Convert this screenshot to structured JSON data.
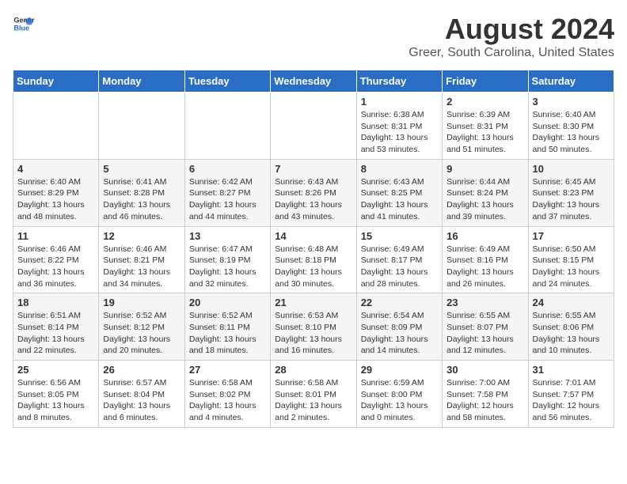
{
  "logo": {
    "line1": "General",
    "line2": "Blue"
  },
  "title": "August 2024",
  "subtitle": "Greer, South Carolina, United States",
  "weekdays": [
    "Sunday",
    "Monday",
    "Tuesday",
    "Wednesday",
    "Thursday",
    "Friday",
    "Saturday"
  ],
  "weeks": [
    [
      {
        "day": "",
        "info": ""
      },
      {
        "day": "",
        "info": ""
      },
      {
        "day": "",
        "info": ""
      },
      {
        "day": "",
        "info": ""
      },
      {
        "day": "1",
        "info": "Sunrise: 6:38 AM\nSunset: 8:31 PM\nDaylight: 13 hours\nand 53 minutes."
      },
      {
        "day": "2",
        "info": "Sunrise: 6:39 AM\nSunset: 8:31 PM\nDaylight: 13 hours\nand 51 minutes."
      },
      {
        "day": "3",
        "info": "Sunrise: 6:40 AM\nSunset: 8:30 PM\nDaylight: 13 hours\nand 50 minutes."
      }
    ],
    [
      {
        "day": "4",
        "info": "Sunrise: 6:40 AM\nSunset: 8:29 PM\nDaylight: 13 hours\nand 48 minutes."
      },
      {
        "day": "5",
        "info": "Sunrise: 6:41 AM\nSunset: 8:28 PM\nDaylight: 13 hours\nand 46 minutes."
      },
      {
        "day": "6",
        "info": "Sunrise: 6:42 AM\nSunset: 8:27 PM\nDaylight: 13 hours\nand 44 minutes."
      },
      {
        "day": "7",
        "info": "Sunrise: 6:43 AM\nSunset: 8:26 PM\nDaylight: 13 hours\nand 43 minutes."
      },
      {
        "day": "8",
        "info": "Sunrise: 6:43 AM\nSunset: 8:25 PM\nDaylight: 13 hours\nand 41 minutes."
      },
      {
        "day": "9",
        "info": "Sunrise: 6:44 AM\nSunset: 8:24 PM\nDaylight: 13 hours\nand 39 minutes."
      },
      {
        "day": "10",
        "info": "Sunrise: 6:45 AM\nSunset: 8:23 PM\nDaylight: 13 hours\nand 37 minutes."
      }
    ],
    [
      {
        "day": "11",
        "info": "Sunrise: 6:46 AM\nSunset: 8:22 PM\nDaylight: 13 hours\nand 36 minutes."
      },
      {
        "day": "12",
        "info": "Sunrise: 6:46 AM\nSunset: 8:21 PM\nDaylight: 13 hours\nand 34 minutes."
      },
      {
        "day": "13",
        "info": "Sunrise: 6:47 AM\nSunset: 8:19 PM\nDaylight: 13 hours\nand 32 minutes."
      },
      {
        "day": "14",
        "info": "Sunrise: 6:48 AM\nSunset: 8:18 PM\nDaylight: 13 hours\nand 30 minutes."
      },
      {
        "day": "15",
        "info": "Sunrise: 6:49 AM\nSunset: 8:17 PM\nDaylight: 13 hours\nand 28 minutes."
      },
      {
        "day": "16",
        "info": "Sunrise: 6:49 AM\nSunset: 8:16 PM\nDaylight: 13 hours\nand 26 minutes."
      },
      {
        "day": "17",
        "info": "Sunrise: 6:50 AM\nSunset: 8:15 PM\nDaylight: 13 hours\nand 24 minutes."
      }
    ],
    [
      {
        "day": "18",
        "info": "Sunrise: 6:51 AM\nSunset: 8:14 PM\nDaylight: 13 hours\nand 22 minutes."
      },
      {
        "day": "19",
        "info": "Sunrise: 6:52 AM\nSunset: 8:12 PM\nDaylight: 13 hours\nand 20 minutes."
      },
      {
        "day": "20",
        "info": "Sunrise: 6:52 AM\nSunset: 8:11 PM\nDaylight: 13 hours\nand 18 minutes."
      },
      {
        "day": "21",
        "info": "Sunrise: 6:53 AM\nSunset: 8:10 PM\nDaylight: 13 hours\nand 16 minutes."
      },
      {
        "day": "22",
        "info": "Sunrise: 6:54 AM\nSunset: 8:09 PM\nDaylight: 13 hours\nand 14 minutes."
      },
      {
        "day": "23",
        "info": "Sunrise: 6:55 AM\nSunset: 8:07 PM\nDaylight: 13 hours\nand 12 minutes."
      },
      {
        "day": "24",
        "info": "Sunrise: 6:55 AM\nSunset: 8:06 PM\nDaylight: 13 hours\nand 10 minutes."
      }
    ],
    [
      {
        "day": "25",
        "info": "Sunrise: 6:56 AM\nSunset: 8:05 PM\nDaylight: 13 hours\nand 8 minutes."
      },
      {
        "day": "26",
        "info": "Sunrise: 6:57 AM\nSunset: 8:04 PM\nDaylight: 13 hours\nand 6 minutes."
      },
      {
        "day": "27",
        "info": "Sunrise: 6:58 AM\nSunset: 8:02 PM\nDaylight: 13 hours\nand 4 minutes."
      },
      {
        "day": "28",
        "info": "Sunrise: 6:58 AM\nSunset: 8:01 PM\nDaylight: 13 hours\nand 2 minutes."
      },
      {
        "day": "29",
        "info": "Sunrise: 6:59 AM\nSunset: 8:00 PM\nDaylight: 13 hours\nand 0 minutes."
      },
      {
        "day": "30",
        "info": "Sunrise: 7:00 AM\nSunset: 7:58 PM\nDaylight: 12 hours\nand 58 minutes."
      },
      {
        "day": "31",
        "info": "Sunrise: 7:01 AM\nSunset: 7:57 PM\nDaylight: 12 hours\nand 56 minutes."
      }
    ]
  ]
}
